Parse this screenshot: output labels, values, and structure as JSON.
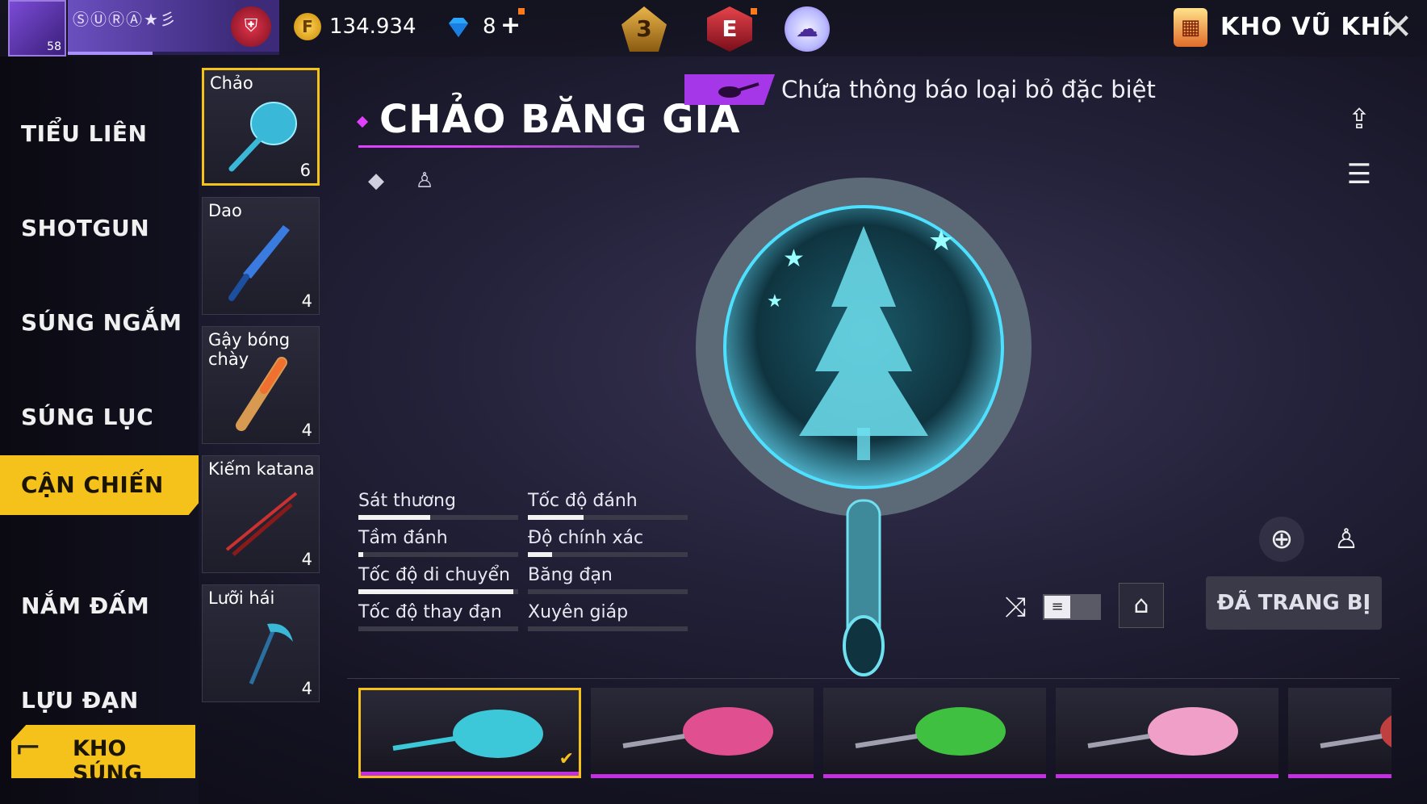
{
  "topbar": {
    "level": "58",
    "nickname": "ⓈⓊⓇⒶ★彡",
    "coins": "134.934",
    "diamonds": "8",
    "diamonds_plus": "+",
    "rank_badge": "3",
    "elite_badge": "E",
    "vault_title": "KHO VŨ KHÍ",
    "close_glyph": "✕",
    "colors": {
      "gold": "#f5c21b",
      "accent": "#e040fb"
    }
  },
  "nav": {
    "items": [
      {
        "label": "TIỂU LIÊN"
      },
      {
        "label": "SHOTGUN"
      },
      {
        "label": "SÚNG NGẮM"
      },
      {
        "label": "SÚNG LỤC"
      },
      {
        "label": "CẬN CHIẾN",
        "active": true
      },
      {
        "label": "NẮM ĐẤM"
      },
      {
        "label": "LỰU ĐẠN"
      }
    ],
    "kho_sung": "KHO SÚNG"
  },
  "weapons": [
    {
      "name": "Chảo",
      "count": "6",
      "selected": true
    },
    {
      "name": "Dao",
      "count": "4"
    },
    {
      "name": "Gậy bóng chày",
      "count": "4"
    },
    {
      "name": "Kiếm katana",
      "count": "4"
    },
    {
      "name": "Lưỡi hái",
      "count": "4"
    }
  ],
  "detail": {
    "title": "CHẢO BĂNG GIÁ",
    "notice": "Chứa thông báo loại bỏ đặc biệt",
    "stats": [
      {
        "label": "Sát thương",
        "value": 0.45
      },
      {
        "label": "Tốc độ đánh",
        "value": 0.35
      },
      {
        "label": "Tầm đánh",
        "value": 0.03
      },
      {
        "label": "Độ chính xác",
        "value": 0.15
      },
      {
        "label": "Tốc độ di chuyển",
        "value": 0.97
      },
      {
        "label": "Băng đạn",
        "value": 0
      },
      {
        "label": "Tốc độ thay đạn",
        "value": 0
      },
      {
        "label": "Xuyên giáp",
        "value": 0
      }
    ],
    "equipped_label": "ĐÃ TRANG BỊ",
    "toggle_glyph": "≡"
  },
  "skins": [
    {
      "selected": true,
      "color": "#3cc8d8"
    },
    {
      "selected": false,
      "color": "#e05090"
    },
    {
      "selected": false,
      "color": "#40c040"
    },
    {
      "selected": false,
      "color": "#f0a0c8"
    },
    {
      "selected": false,
      "color": "#c04040"
    }
  ]
}
